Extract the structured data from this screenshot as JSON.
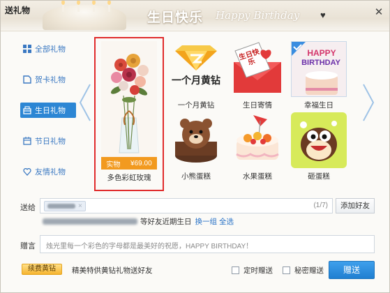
{
  "window": {
    "title": "送礼物",
    "close_icon": "close-icon"
  },
  "banner": {
    "title": "生日快乐",
    "subtitle": "Happy Birthday",
    "heart_icon": "heart-icon"
  },
  "sidebar": {
    "items": [
      {
        "label": "全部礼物",
        "icon": "grid-icon"
      },
      {
        "label": "贺卡礼物",
        "icon": "card-icon"
      },
      {
        "label": "生日礼物",
        "icon": "gift-box-icon"
      },
      {
        "label": "节日礼物",
        "icon": "calendar-icon"
      },
      {
        "label": "友情礼物",
        "icon": "heart-outline-icon"
      }
    ],
    "active_index": 2
  },
  "gifts": {
    "selected": {
      "name": "多色彩虹玫瑰",
      "tag": "实物",
      "price": "¥69.00"
    },
    "items": [
      {
        "name": "一个月黄钻",
        "caption": "一个月黄钻"
      },
      {
        "name": "生日寄情",
        "caption": "生日快乐"
      },
      {
        "name": "幸福生日",
        "caption_top": "HAPPY",
        "caption_bottom": "BIRTHDAY"
      },
      {
        "name": "小熊蛋糕"
      },
      {
        "name": "水果蛋糕"
      },
      {
        "name": "砸蛋糕"
      }
    ]
  },
  "form": {
    "to_label": "送给",
    "recipient_count": "(1/7)",
    "add_friend": "添加好友",
    "birthday_text": "等好友近期生日",
    "change_link": "换一组",
    "select_all_link": "全选",
    "message_label": "赠言",
    "message": "烛光里每一个彩色的字母都是最美好的祝愿，HAPPY BIRTHDAY！"
  },
  "footer": {
    "vip_button": "续费黄钻",
    "vip_tip": "精美特供黄钻礼物送好友",
    "timed_send": "定时赠送",
    "secret_send": "秘密赠送",
    "send_button": "赠送"
  },
  "colors": {
    "accent": "#2c86d4",
    "selected_border": "#e02b2b",
    "price": "#f29a1f"
  }
}
